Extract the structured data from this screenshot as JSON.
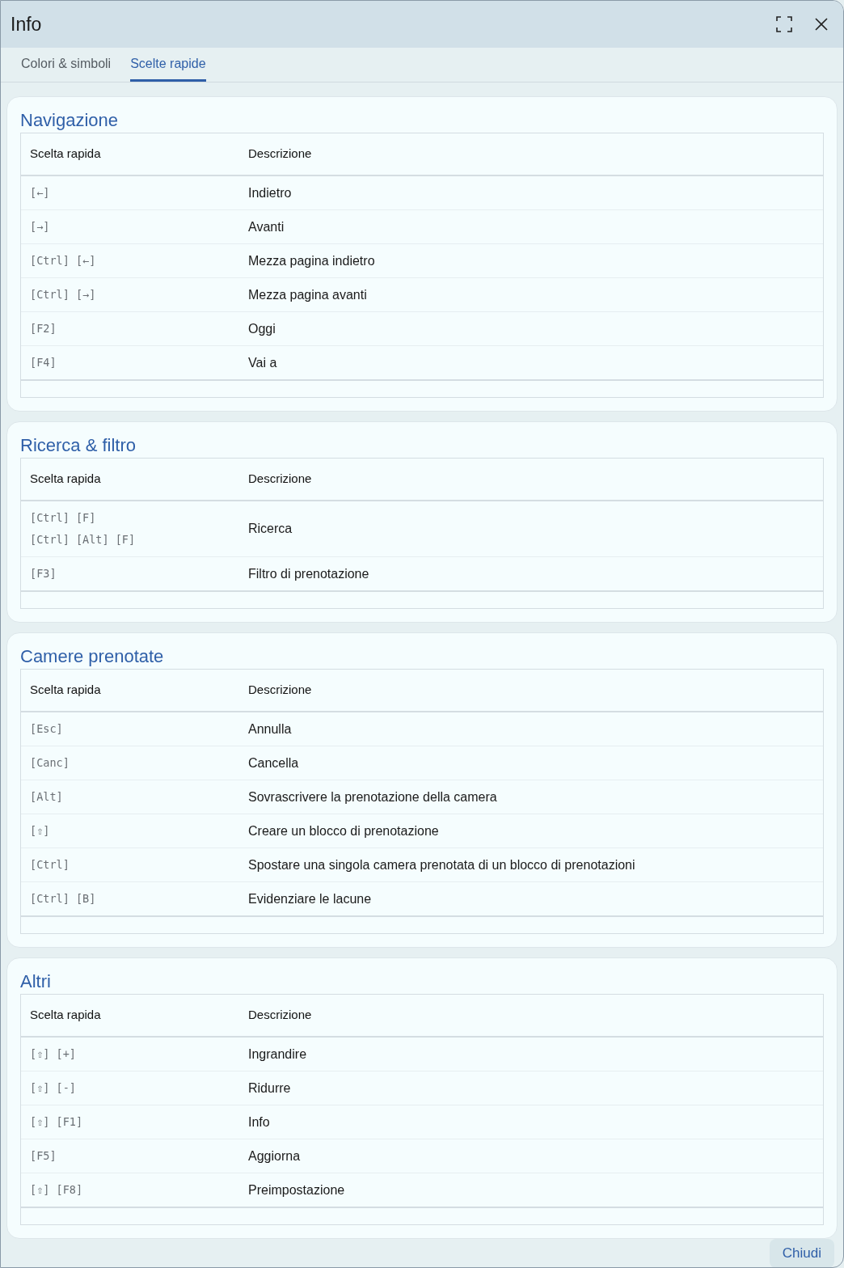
{
  "window": {
    "title": "Info"
  },
  "tabs": [
    {
      "label": "Colori & simboli",
      "selected": false
    },
    {
      "label": "Scelte rapide",
      "selected": true
    }
  ],
  "sections": [
    {
      "title": "Navigazione",
      "columns": [
        "Scelta rapida",
        "Descrizione"
      ],
      "rows": [
        {
          "keys": [
            "[←]"
          ],
          "description": "Indietro"
        },
        {
          "keys": [
            "[→]"
          ],
          "description": "Avanti"
        },
        {
          "keys": [
            "[Ctrl] [←]"
          ],
          "description": "Mezza pagina indietro"
        },
        {
          "keys": [
            "[Ctrl] [→]"
          ],
          "description": "Mezza pagina avanti"
        },
        {
          "keys": [
            "[F2]"
          ],
          "description": "Oggi"
        },
        {
          "keys": [
            "[F4]"
          ],
          "description": "Vai a"
        }
      ]
    },
    {
      "title": "Ricerca & filtro",
      "columns": [
        "Scelta rapida",
        "Descrizione"
      ],
      "rows": [
        {
          "keys": [
            "[Ctrl] [F]",
            "[Ctrl] [Alt] [F]"
          ],
          "description": "Ricerca"
        },
        {
          "keys": [
            "[F3]"
          ],
          "description": "Filtro di prenotazione"
        }
      ]
    },
    {
      "title": "Camere prenotate",
      "columns": [
        "Scelta rapida",
        "Descrizione"
      ],
      "rows": [
        {
          "keys": [
            "[Esc]"
          ],
          "description": "Annulla"
        },
        {
          "keys": [
            "[Canc]"
          ],
          "description": "Cancella"
        },
        {
          "keys": [
            "[Alt]"
          ],
          "description": "Sovrascrivere la prenotazione della camera"
        },
        {
          "keys": [
            "[⇧]"
          ],
          "description": "Creare un blocco di prenotazione"
        },
        {
          "keys": [
            "[Ctrl]"
          ],
          "description": "Spostare una singola camera prenotata di un blocco di prenotazioni"
        },
        {
          "keys": [
            "[Ctrl] [B]"
          ],
          "description": "Evidenziare le lacune"
        }
      ]
    },
    {
      "title": "Altri",
      "columns": [
        "Scelta rapida",
        "Descrizione"
      ],
      "rows": [
        {
          "keys": [
            "[⇧] [+]"
          ],
          "description": "Ingrandire"
        },
        {
          "keys": [
            "[⇧] [-]"
          ],
          "description": "Ridurre"
        },
        {
          "keys": [
            "[⇧] [F1]"
          ],
          "description": "Info"
        },
        {
          "keys": [
            "[F5]"
          ],
          "description": "Aggiorna"
        },
        {
          "keys": [
            "[⇧] [F8]"
          ],
          "description": "Preimpostazione"
        }
      ]
    }
  ],
  "footer": {
    "button": "Chiudi"
  }
}
